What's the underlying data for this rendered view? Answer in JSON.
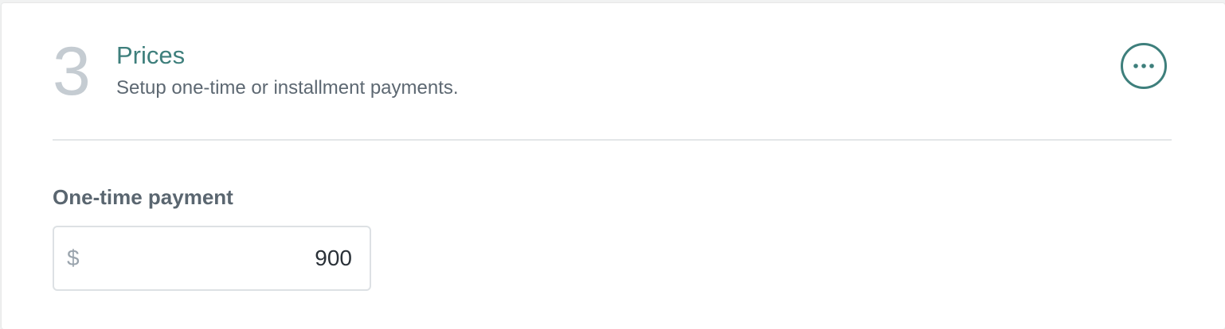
{
  "section": {
    "step_number": "3",
    "title": "Prices",
    "subtitle": "Setup one-time or installment payments.",
    "more_icon": "more-horizontal-icon"
  },
  "one_time_payment": {
    "label": "One-time payment",
    "currency_symbol": "$",
    "value": "900"
  },
  "colors": {
    "accent": "#3e7f7c",
    "step_number": "#c5ccd2",
    "label": "#5a6670",
    "border": "#dde1e4"
  }
}
